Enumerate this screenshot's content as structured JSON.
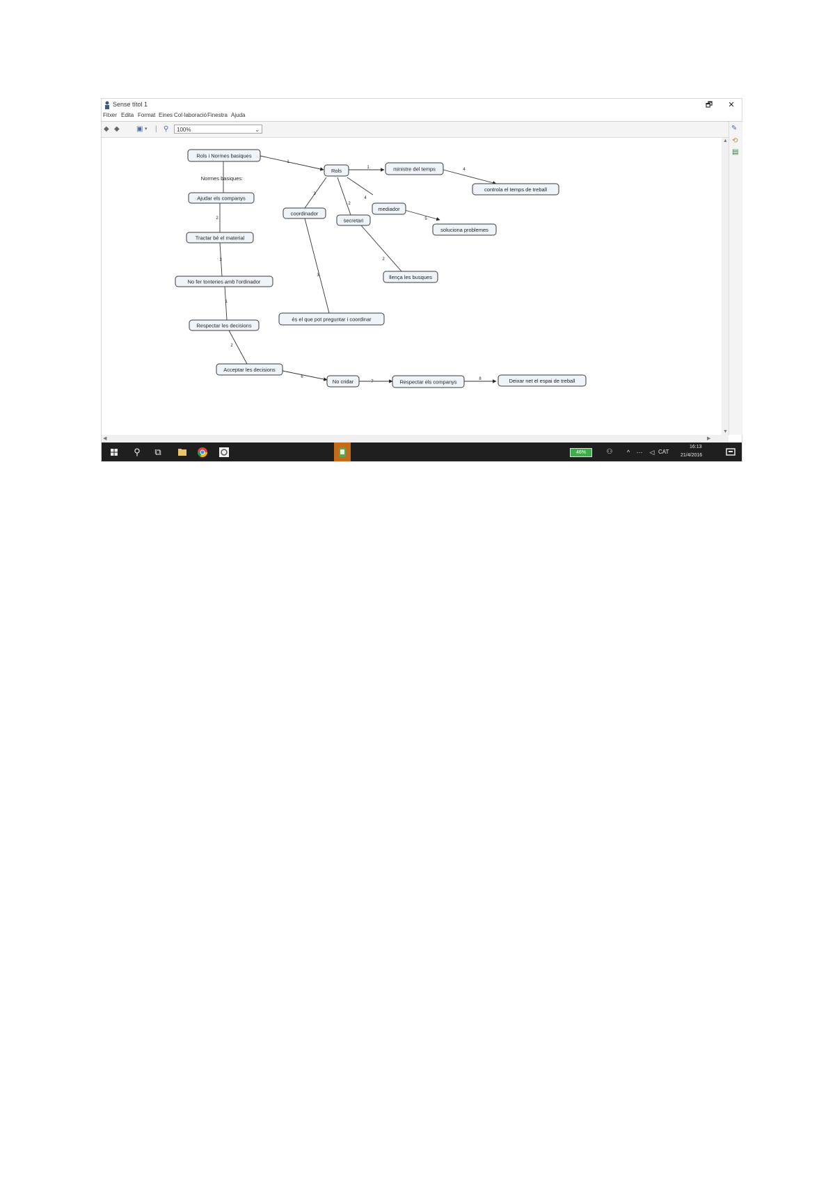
{
  "window": {
    "title": "Sense títol 1",
    "controls": {
      "restore": "🗗",
      "close": "✕"
    }
  },
  "menubar": {
    "items": [
      "Fitxer",
      "Edita",
      "Format",
      "Eines",
      "Col·laboració",
      "Finestra",
      "Ajuda"
    ]
  },
  "toolbar": {
    "zoom_value": "100%",
    "icons": [
      "back-icon",
      "forward-icon",
      "save-icon",
      "zoom-icon"
    ]
  },
  "concept_map": {
    "nodes": [
      {
        "id": "n1",
        "label": "Rols i Normes basiques"
      },
      {
        "id": "n2",
        "label": "Rols"
      },
      {
        "id": "n3",
        "label": "ministre del temps"
      },
      {
        "id": "n4",
        "label": "controla el temps de treball"
      },
      {
        "id": "n5",
        "label": "mediador"
      },
      {
        "id": "n6",
        "label": "soluciona problemes"
      },
      {
        "id": "n7",
        "label": "coordinador"
      },
      {
        "id": "n8",
        "label": "secretari"
      },
      {
        "id": "n9",
        "label": "llença les busques"
      },
      {
        "id": "n10",
        "label": "és el que pot preguntar i coordinar"
      },
      {
        "id": "n11",
        "label": "Ajudar els companys"
      },
      {
        "id": "n12",
        "label": "Tractar bé el material"
      },
      {
        "id": "n13",
        "label": "No fer tonteries amb l'ordinador"
      },
      {
        "id": "n14",
        "label": "Respectar les decisions"
      },
      {
        "id": "n15",
        "label": "Acceptar les decisions"
      },
      {
        "id": "n16",
        "label": "No cridar"
      },
      {
        "id": "n17",
        "label": "Respectar els companys"
      },
      {
        "id": "n18",
        "label": "Deixar net el espai de treball"
      }
    ],
    "link_label": "Normes basiques:",
    "link_numbers": [
      "1",
      "1",
      "4",
      "3",
      "2",
      "5",
      "2",
      "3",
      "4",
      "2",
      "3",
      "6",
      "7",
      "8",
      "1",
      "2"
    ]
  },
  "taskbar": {
    "battery": "46%",
    "language": "CAT",
    "time": "16:13",
    "date": "21/4/2016"
  }
}
